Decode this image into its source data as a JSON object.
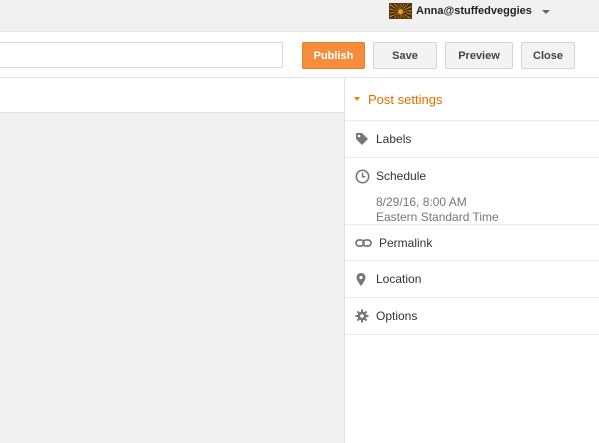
{
  "account": {
    "name": "Anna@stuffedveggies"
  },
  "header": {
    "title_value": "",
    "buttons": {
      "publish": "Publish",
      "save": "Save",
      "preview": "Preview",
      "close": "Close"
    }
  },
  "post_settings": {
    "title": "Post settings",
    "items": {
      "labels": "Labels",
      "schedule": {
        "label": "Schedule",
        "datetime": "8/29/16, 8:00 AM",
        "timezone": "Eastern Standard Time"
      },
      "permalink": "Permalink",
      "location": "Location",
      "options": "Options"
    }
  },
  "colors": {
    "accent": "#f58e3a",
    "panel_title": "#e66d00"
  }
}
